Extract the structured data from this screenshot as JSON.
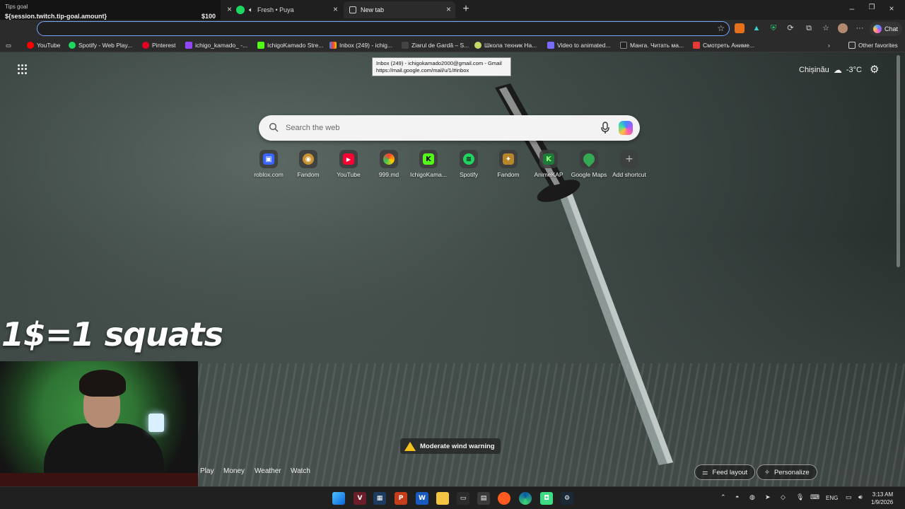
{
  "overlay": {
    "tips_title": "Tips goal",
    "tips_variable": "${session.twitch.tip-goal.amount}",
    "tips_amount": "$100",
    "squats_text": "1$=1 squats"
  },
  "tabs": [
    {
      "label": "",
      "icon": "stream-overlay-tab"
    },
    {
      "label": "Fresh • Puya",
      "icon": "spotify-icon",
      "audio": "speaker-icon"
    },
    {
      "label": "New tab",
      "icon": "newtab-icon",
      "active": true
    }
  ],
  "toolbar": {
    "chat_label": "Chat"
  },
  "bookmarks": [
    {
      "label": "YouTube",
      "color": "#ff0000"
    },
    {
      "label": "Spotify - Web Play...",
      "color": "#1ed760"
    },
    {
      "label": "Pinterest",
      "color": "#e60023"
    },
    {
      "label": "ichigo_kamado_ -...",
      "color": "#9146ff"
    },
    {
      "label": "IchigoKamado Stre...",
      "color": "#53fc18"
    },
    {
      "label": "Inbox (249) - ichig...",
      "color": "#ea4335"
    },
    {
      "label": "Ziarul de Gardă – S...",
      "color": "#444444"
    },
    {
      "label": "Школа техник На...",
      "color": "#c9d66a"
    },
    {
      "label": "Video to animated...",
      "color": "#7a6cff"
    },
    {
      "label": "Манга. Читать ма...",
      "color": "#222222"
    },
    {
      "label": "Смотреть Аниме...",
      "color": "#e53935"
    }
  ],
  "other_favorites": "Other favorites",
  "tooltip": {
    "line1": "Inbox (249) - ichigokamado2000@gmail.com - Gmail",
    "line2": "https://mail.google.com/mail/u/1/#inbox"
  },
  "weather": {
    "city": "Chișinău",
    "temp": "-3°C"
  },
  "search": {
    "placeholder": "Search the web"
  },
  "shortcuts": [
    {
      "label": "roblox.com",
      "color": "#3a66ff",
      "glyph": "▣"
    },
    {
      "label": "Fandom",
      "color": "#c8932f",
      "glyph": "◉"
    },
    {
      "label": "YouTube",
      "color": "#ff0033",
      "glyph": "▶"
    },
    {
      "label": "999.md",
      "color": "#ff6a00",
      "glyph": "◐"
    },
    {
      "label": "IchigoKama...",
      "color": "#53fc18",
      "glyph": "K"
    },
    {
      "label": "Spotify",
      "color": "#1ed760",
      "glyph": "≋"
    },
    {
      "label": "Fandom",
      "color": "#b8862a",
      "glyph": "✦"
    },
    {
      "label": "AnimeKAP",
      "color": "#1f7a3a",
      "glyph": "K"
    },
    {
      "label": "Google Maps",
      "color": "#34a853",
      "glyph": "◆"
    },
    {
      "label": "Add shortcut",
      "color": "#5a5a5a",
      "glyph": "+"
    }
  ],
  "wind_warning": "Moderate wind warning",
  "feed_nav": [
    "Play",
    "Money",
    "Weather",
    "Watch"
  ],
  "feed_layout_label": "Feed layout",
  "personalize_label": "Personalize",
  "taskbar": {
    "language": "ENG",
    "time": "3:13 AM",
    "date": "1/9/2026"
  }
}
